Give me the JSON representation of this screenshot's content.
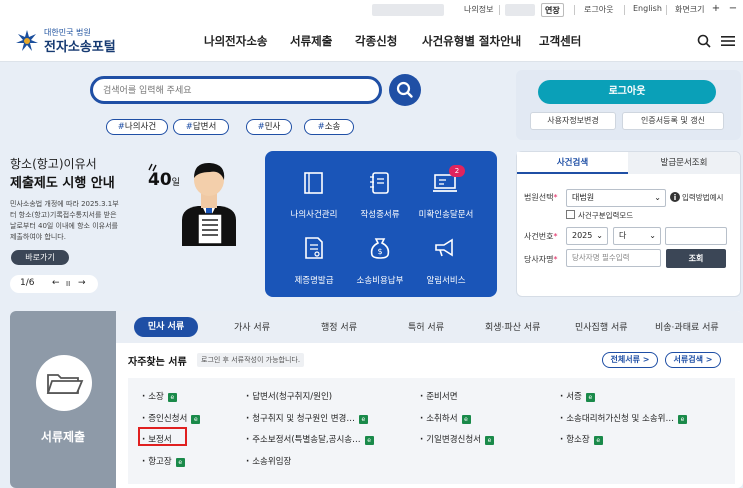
{
  "util": {
    "my_info": "나의정보",
    "extend": "연장",
    "logout": "로그아웃",
    "english": "English",
    "zoom_label": "화면크기",
    "zoom_in": "+",
    "zoom_out": "−"
  },
  "header": {
    "logo_small": "대한민국 법원",
    "logo_big": "전자소송포털",
    "nav": [
      "나의전자소송",
      "서류제출",
      "각종신청",
      "사건유형별 절차안내",
      "고객센터"
    ]
  },
  "search": {
    "placeholder": "검색어를 입력해 주세요",
    "tags": [
      "나의사건",
      "답변서",
      "민사",
      "소송"
    ]
  },
  "login": {
    "logout_button": "로그아웃",
    "btn_user_cert_change": "사용자정보변경",
    "btn_cert_register": "인증서등록 및 갱신"
  },
  "banner": {
    "line1": "항소(항고)이유서",
    "line2": "제출제도 시행 안내",
    "body": [
      "민사소송법 개정에 따라 2025.3.1부",
      "터 항소(항고)기록접수통지서를 받은",
      "날로부터 40일 이내에 항소 이유서를",
      "제출하여야 합니다."
    ],
    "days_num": "40",
    "days_unit": "일",
    "goto": "바로가기",
    "page": "1/6",
    "prev": "←",
    "pause": "II",
    "next": "→"
  },
  "services": {
    "items": [
      "나의사건관리",
      "작성중서류",
      "미확인송달문서",
      "제증명발급",
      "소송비용납부",
      "알림서비스"
    ],
    "badge": "2"
  },
  "case_search": {
    "tab_active": "사건검색",
    "tab_inactive": "발급문서조회",
    "court_label": "법원선택",
    "court_value": "대법원",
    "help": "입력방법예시",
    "mode_label": "사건구분입력모드",
    "number_label": "사건번호",
    "year_value": "2025",
    "type_value": "다",
    "party_label": "당사자명",
    "party_placeholder": "당사자명 필수입력",
    "search_button": "조회"
  },
  "documents": {
    "left_label": "서류제출",
    "tabs": [
      "민사 서류",
      "가사 서류",
      "행정 서류",
      "특허 서류",
      "회생·파산 서류",
      "민사집행 서류",
      "비송·과태료 서류"
    ],
    "fav_title": "자주찾는 서류",
    "fav_hint": "로그인 후 서류작성이 가능합니다.",
    "btn_all": "전체서류 >",
    "btn_search": "서류검색 >",
    "items": [
      [
        "소장",
        "답변서(청구취지/원인)",
        "준비서면",
        "서증"
      ],
      [
        "증인신청서",
        "청구취지 및 청구원인 변경…",
        "소취하서",
        "소송대리허가신청 및 소송위…"
      ],
      [
        "보정서",
        "주소보정서(특별송달,공시송…",
        "기일변경신청서",
        "항소장"
      ],
      [
        "항고장",
        "소송위임장",
        "",
        ""
      ]
    ]
  }
}
